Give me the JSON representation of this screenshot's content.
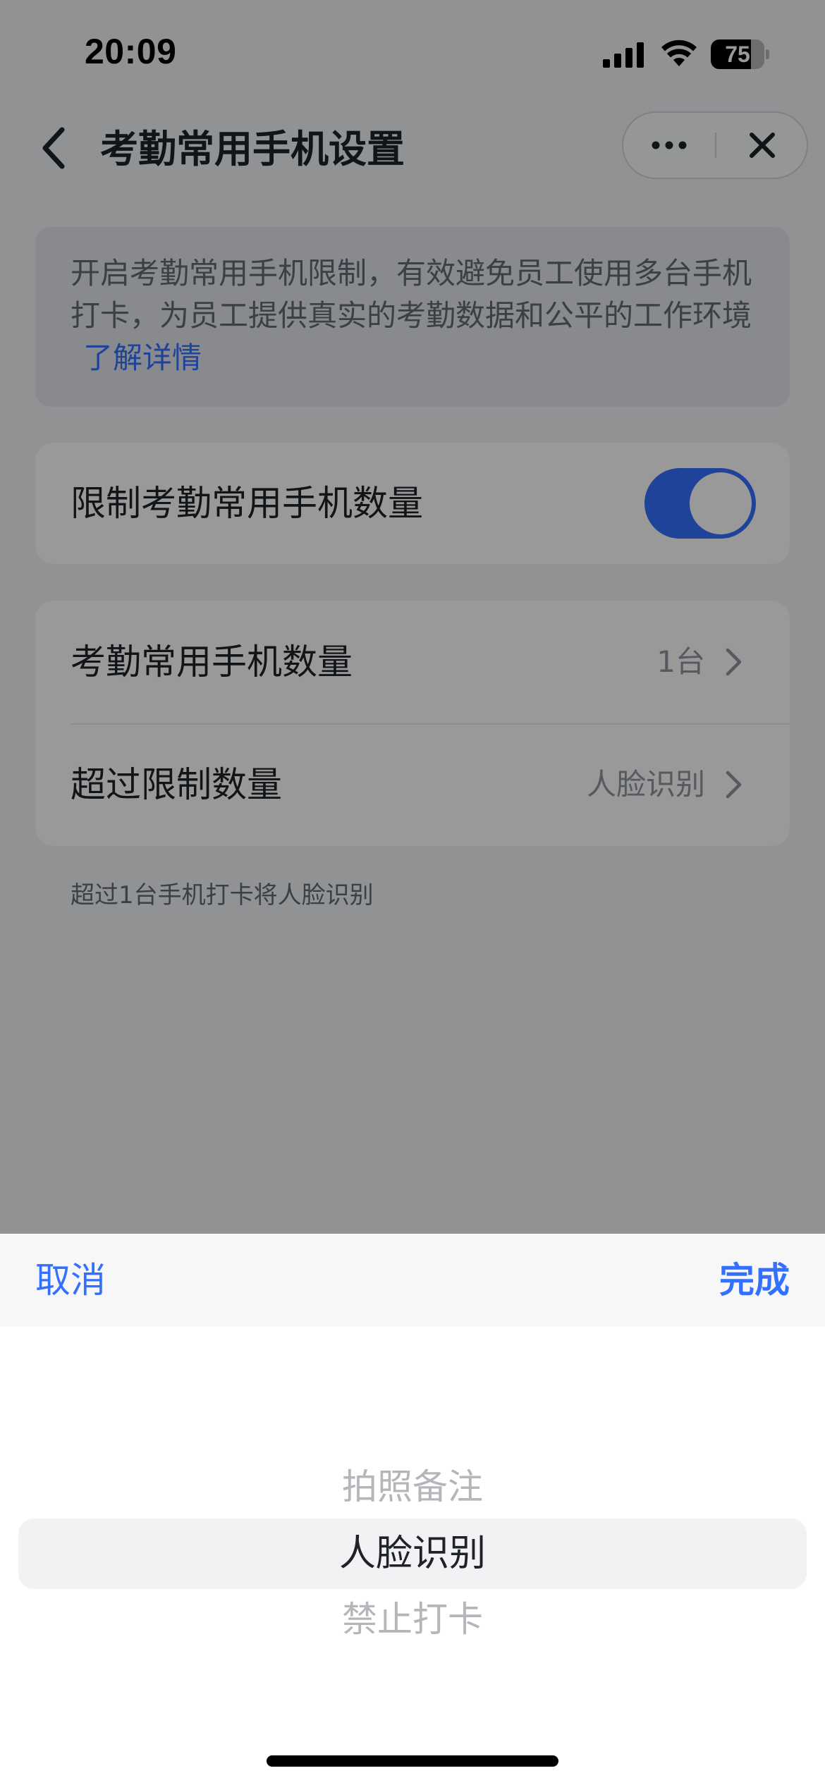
{
  "status_bar": {
    "time": "20:09",
    "battery_level": "75",
    "battery_fraction": 0.75,
    "signal_icon": "cellular-signal-icon",
    "wifi_icon": "wifi-icon"
  },
  "nav": {
    "back_icon": "chevron-left-icon",
    "title": "考勤常用手机设置",
    "more_icon": "more-dots-icon",
    "close_icon": "close-icon"
  },
  "info": {
    "text": "开启考勤常用手机限制，有效避免员工使用多台手机打卡，为员工提供真实的考勤数据和公平的工作环境",
    "link": "了解详情"
  },
  "limit_toggle": {
    "label": "限制考勤常用手机数量",
    "enabled": true
  },
  "settings": [
    {
      "label": "考勤常用手机数量",
      "value": "1台"
    },
    {
      "label": "超过限制数量",
      "value": "人脸识别"
    }
  ],
  "helper_text": "超过1台手机打卡将人脸识别",
  "picker": {
    "cancel": "取消",
    "done": "完成",
    "options": [
      "拍照备注",
      "人脸识别",
      "禁止打卡"
    ],
    "selected_index": 1
  },
  "colors": {
    "accent": "#3370ff",
    "overlay": "rgba(0,0,0,0.40)"
  }
}
